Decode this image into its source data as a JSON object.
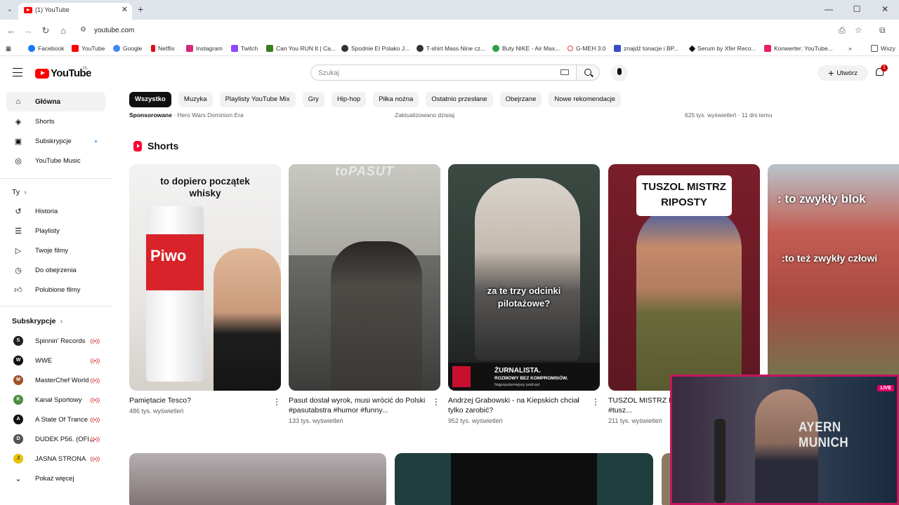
{
  "browser": {
    "tab_title": "(1) YouTube",
    "url": "youtube.com",
    "bookmarks": [
      {
        "label": "Facebook",
        "color": "#1877f2"
      },
      {
        "label": "YouTube",
        "color": "#ff0000"
      },
      {
        "label": "Google",
        "color": "#4285f4"
      },
      {
        "label": "Netflix",
        "color": "#e50914"
      },
      {
        "label": "Instagram",
        "color": "#d62976"
      },
      {
        "label": "Twitch",
        "color": "#9146ff"
      },
      {
        "label": "Can You RUN It | Ca...",
        "color": "#3b7d23"
      },
      {
        "label": "Spodnie El Polako J...",
        "color": "#333333"
      },
      {
        "label": "T-shirt Mass Nine cz...",
        "color": "#333333"
      },
      {
        "label": "Buty NIKE - Air Max...",
        "color": "#2ea043"
      },
      {
        "label": "G-MEH 3.0",
        "color": "#e04040"
      },
      {
        "label": "znajdź tonacje i BP...",
        "color": "#3b4cc0"
      },
      {
        "label": "Serum by Xfer Reco...",
        "color": "#111111"
      },
      {
        "label": "Konwerter: YouTube...",
        "color": "#e91e63"
      },
      {
        "label": "Wszy",
        "color": "#555555"
      }
    ]
  },
  "header": {
    "logo_text": "YouTube",
    "logo_region": "PL",
    "search_placeholder": "Szukaj",
    "create_label": "Utwórz",
    "notification_count": "1"
  },
  "sidebar": {
    "main": [
      {
        "label": "Główna",
        "icon": "home-icon"
      },
      {
        "label": "Shorts",
        "icon": "shorts-icon"
      },
      {
        "label": "Subskrypcje",
        "icon": "subscriptions-icon"
      },
      {
        "label": "YouTube Music",
        "icon": "youtube-music-icon"
      }
    ],
    "you_section": "Ty",
    "you": [
      {
        "label": "Historia",
        "icon": "history-icon"
      },
      {
        "label": "Playlisty",
        "icon": "playlists-icon"
      },
      {
        "label": "Twoje filmy",
        "icon": "your-videos-icon"
      },
      {
        "label": "Do obejrzenia",
        "icon": "watch-later-icon"
      },
      {
        "label": "Polubione filmy",
        "icon": "liked-videos-icon"
      }
    ],
    "subs_section": "Subskrypcje",
    "subs": [
      {
        "label": "Spinnin' Records",
        "color": "#222222",
        "initial": "S"
      },
      {
        "label": "WWE",
        "color": "#111111",
        "initial": "W"
      },
      {
        "label": "MasterChef World",
        "color": "#a0522d",
        "initial": "M"
      },
      {
        "label": "Kanał Sportowy",
        "color": "#4a8f3c",
        "initial": "K"
      },
      {
        "label": "A State Of Trance",
        "color": "#111111",
        "initial": "A"
      },
      {
        "label": "DUDEK P56. (OFI...",
        "color": "#555555",
        "initial": "D"
      },
      {
        "label": "JASNA STRONA",
        "color": "#e6c200",
        "initial": "J"
      }
    ],
    "show_more": "Pokaż więcej"
  },
  "chips": [
    "Wszystko",
    "Muzyka",
    "Playlisty YouTube Mix",
    "Gry",
    "Hip-hop",
    "Piłka nożna",
    "Ostatnio przesłane",
    "Obejrzane",
    "Nowe rekomendacje"
  ],
  "partial_row": {
    "sponsored_label": "Sponsorowane",
    "sponsored_sep": " · ",
    "sponsored_name": "Hero Wars Dominion Era",
    "updated": "Zaktualizowano dzisiaj",
    "views_time": "625 tys. wyświetleń · 11 dni temu"
  },
  "shorts": {
    "title": "Shorts",
    "items": [
      {
        "caption": "to dopiero początek\nwhisky",
        "can_text": "Piwo",
        "title": "Pamiętacie Tesco?",
        "views": "486 tys. wyświetleń"
      },
      {
        "caption": "toPASUT",
        "title": "Pasut dostał wyrok, musi wrócić do Polski  #pasutabstra #humor #funny...",
        "views": "133 tys. wyświetleń"
      },
      {
        "caption": "za te trzy odcinki\npilotażowe?",
        "banner": "ŻURNALISTA.",
        "banner_sub": "ROZMOWY BEZ KOMPROMISÓW.",
        "banner_tag": "Najpopularniejszy podcast",
        "title": "Andrzej Grabowski - na Kiepskich chciał tylko zarobić?",
        "views": "952 tys. wyświetleń"
      },
      {
        "caption": "TUSZOL MISTRZ\nRIPOSTY",
        "title": "TUSZOL MISTRZ RIPOSTY #famemma #tusz...",
        "views": "211 tys. wyświetleń"
      },
      {
        "caption": ": to zwykły blok",
        "caption2": ":to też zwykły człowi",
        "title": "",
        "views": ""
      }
    ]
  },
  "webcam": {
    "live": "LIVE",
    "jersey_text": "AYERN MUNICH"
  }
}
